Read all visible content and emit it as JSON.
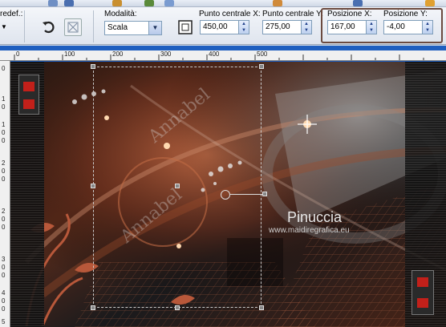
{
  "top_strip": {
    "left_text": "redef.:"
  },
  "toolbar": {
    "modalita": {
      "label": "Modalità:",
      "value": "Scala"
    },
    "punto_x": {
      "label": "Punto centrale X:",
      "value": "450,00"
    },
    "punto_y": {
      "label": "Punto centrale Y:",
      "value": "275,00"
    },
    "pos_x": {
      "label": "Posizione X:",
      "value": "167,00"
    },
    "pos_y": {
      "label": "Posizione Y:",
      "value": "-4,00"
    }
  },
  "ruler_h": [
    "0",
    "100",
    "200",
    "300",
    "400",
    "500"
  ],
  "ruler_v": [
    "0",
    "1",
    "0",
    "1",
    "0",
    "0",
    "2",
    "0",
    "0",
    "2",
    "0",
    "0",
    "3",
    "0",
    "0",
    "4",
    "0",
    "0",
    "5"
  ],
  "canvas": {
    "brand": "Pinuccia",
    "site": "www.maidiregrafica.eu",
    "watermark": "Annabel"
  },
  "colors": {
    "rust": "#b0552e",
    "dark": "#141414",
    "highlight_box": "#6b4a3f",
    "workspace": "#1f5fbf"
  }
}
